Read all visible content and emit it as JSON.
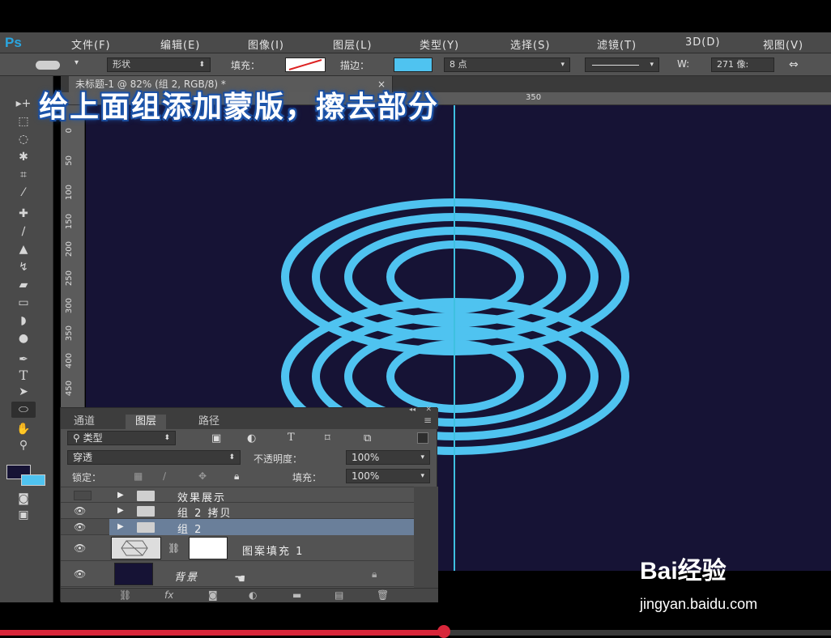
{
  "app": {
    "logo": "Ps"
  },
  "menu": [
    "文件(F)",
    "编辑(E)",
    "图像(I)",
    "图层(L)",
    "类型(Y)",
    "选择(S)",
    "滤镜(T)",
    "3D(D)",
    "视图(V)"
  ],
  "options": {
    "shape_mode": "形状",
    "fill_label": "填充：",
    "stroke_label": "描边：",
    "stroke_size": "8 点",
    "w_label": "W:",
    "w_value": "271 像:"
  },
  "document": {
    "tab_title": "未标题-1 @ 82% (组 2, RGB/8) *",
    "close": "×"
  },
  "ruler_top": [
    "350"
  ],
  "ruler_left": [
    "0",
    "50",
    "100",
    "150",
    "200",
    "250",
    "300",
    "350",
    "400",
    "450"
  ],
  "caption": "给上面组添加蒙版，擦去部分",
  "layers_panel": {
    "tabs": [
      "通道",
      "图层",
      "路径"
    ],
    "filter_kind": "类型",
    "blend_mode": "穿透",
    "opacity_label": "不透明度：",
    "opacity_value": "100%",
    "lock_label": "锁定：",
    "fill_label": "填充：",
    "fill_value": "100%",
    "layers": [
      {
        "name": "效果展示",
        "type": "group",
        "visible": false
      },
      {
        "name": "组 2 拷贝",
        "type": "group",
        "visible": true
      },
      {
        "name": "组 2",
        "type": "group",
        "visible": true,
        "selected": true
      },
      {
        "name": "图案填充 1",
        "type": "fill",
        "visible": true
      },
      {
        "name": "背景",
        "type": "background",
        "visible": true
      }
    ]
  },
  "watermark": {
    "brand": "Bai经验",
    "url": "jingyan.baidu.com"
  },
  "video": {
    "progress": 0.535
  },
  "colors": {
    "ring": "#4fc3f0",
    "canvas_bg": "#161335",
    "guide": "#3ec0e0"
  }
}
